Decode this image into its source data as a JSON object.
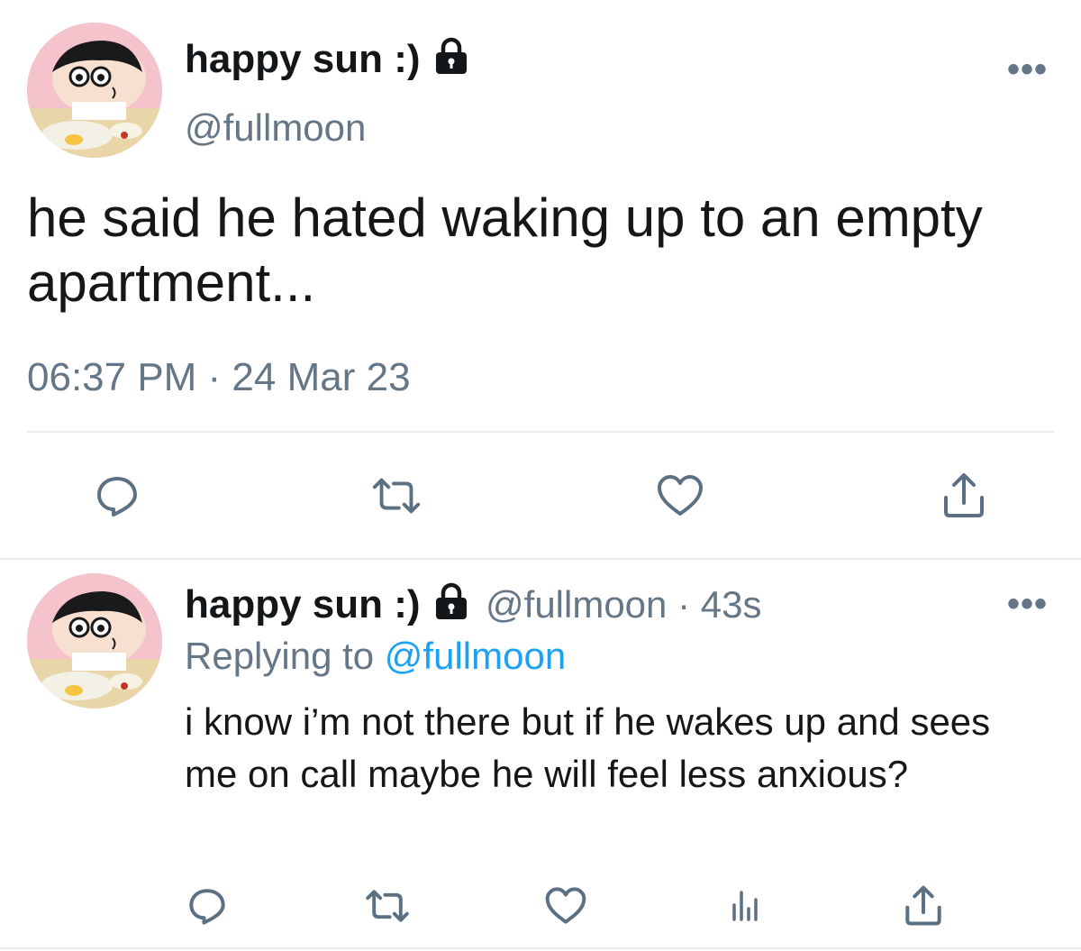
{
  "main_tweet": {
    "display_name": "happy sun :)",
    "handle": "@fullmoon",
    "more_label": "•••",
    "text": "he said he hated waking up to an empty apartment...",
    "timestamp": "06:37 PM · 24 Mar 23",
    "actions": [
      "reply-icon",
      "retweet-icon",
      "like-icon",
      "share-icon"
    ]
  },
  "reply_tweet": {
    "display_name": "happy sun :)",
    "handle_time": "@fullmoon · 43s",
    "more_label": "•••",
    "replying_prefix": "Replying to ",
    "replying_mention": "@fullmoon",
    "text": "i know i’m not there but if he wakes up and sees me on call maybe he will feel less anxious?",
    "actions": [
      "reply-icon",
      "retweet-icon",
      "like-icon",
      "analytics-icon",
      "share-icon"
    ]
  },
  "colors": {
    "text": "#14171a",
    "secondary": "#657786",
    "link": "#1da1f2",
    "divider": "#e6ecf0",
    "icon": "#5b7083"
  }
}
